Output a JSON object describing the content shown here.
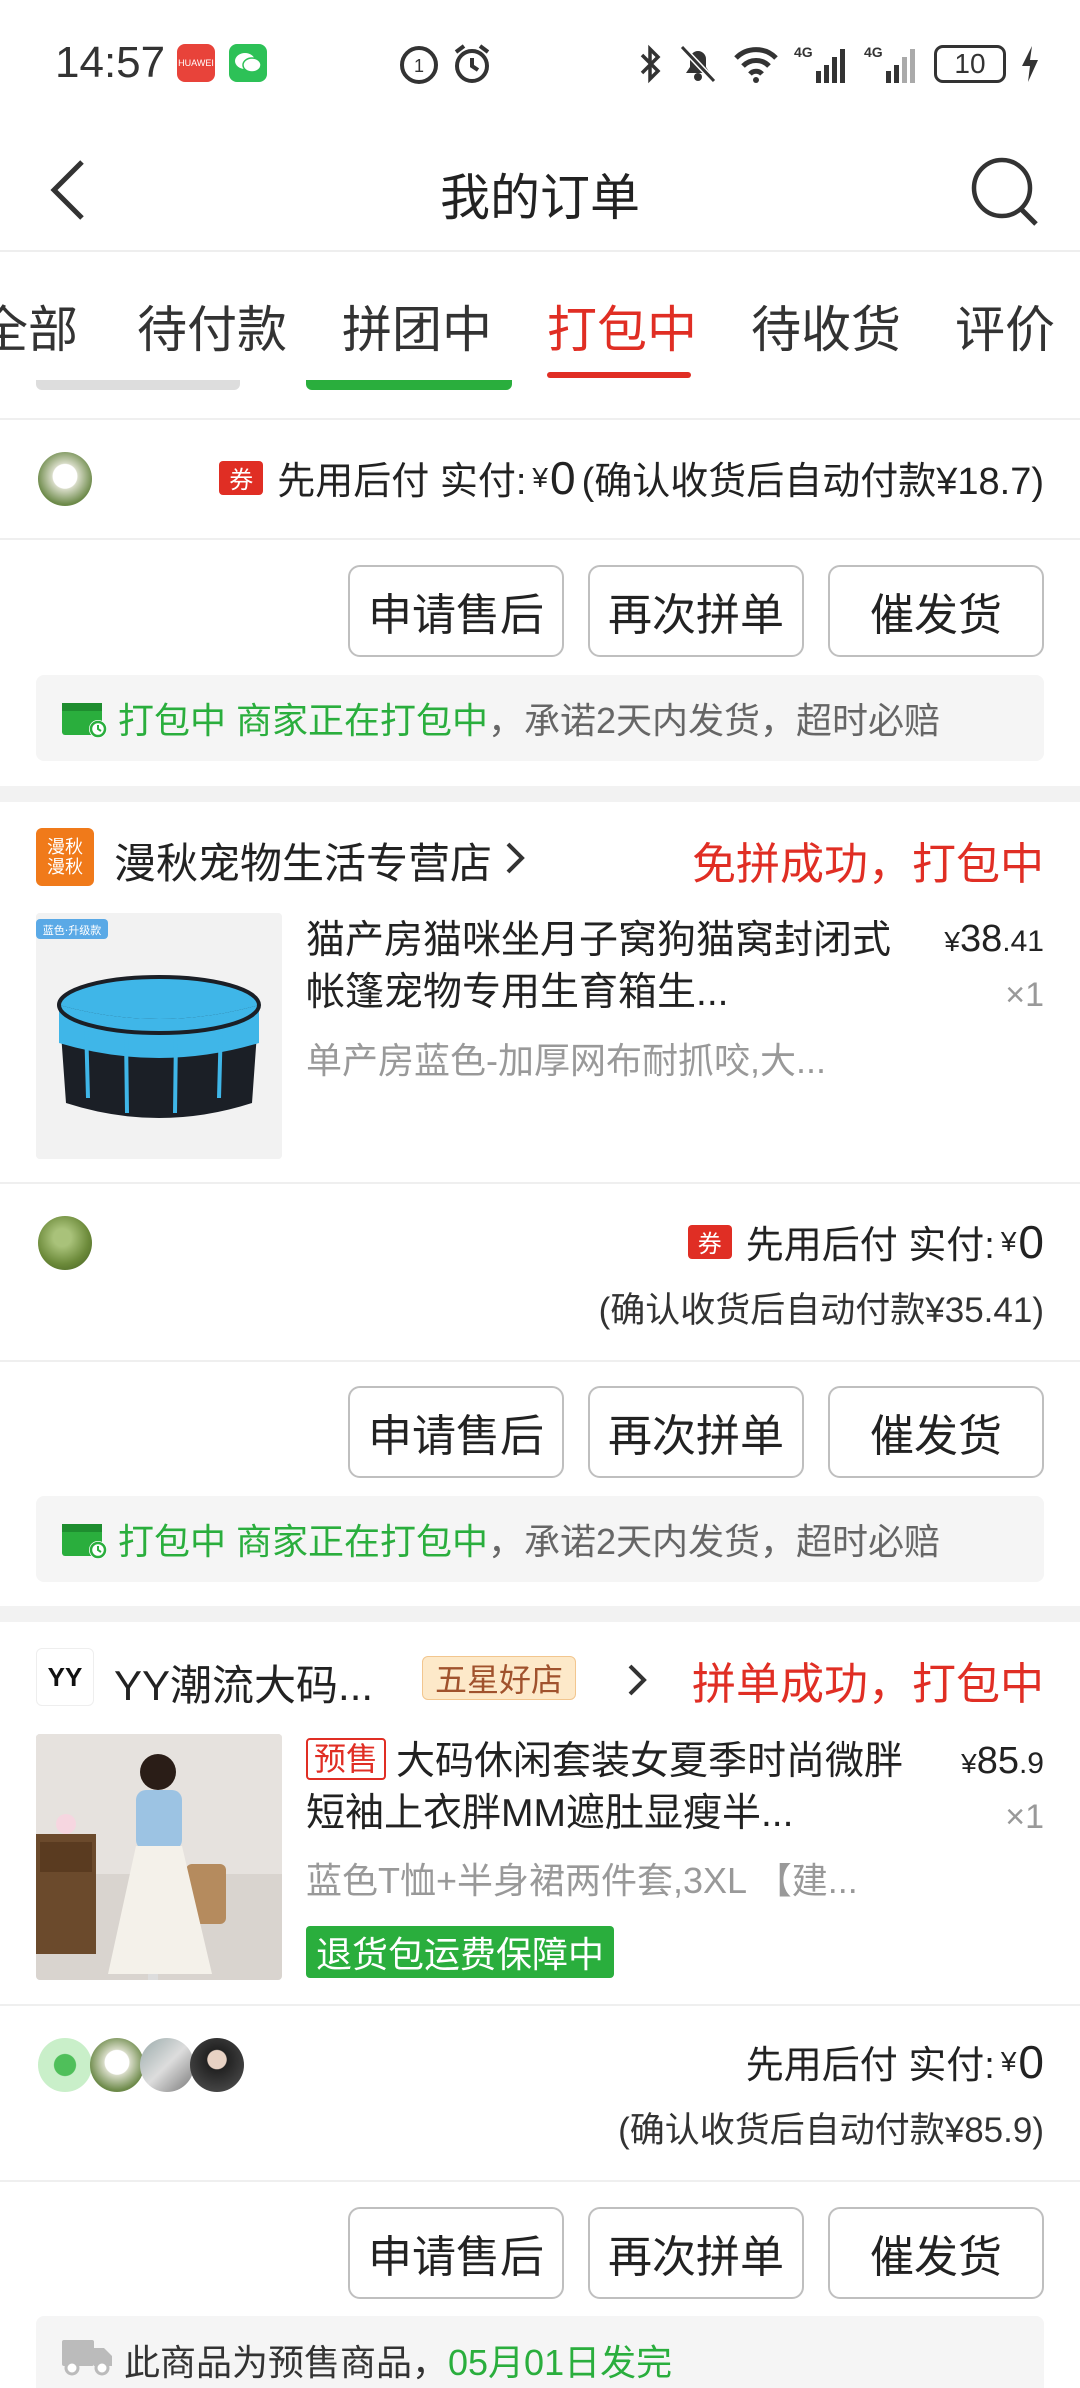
{
  "status_bar": {
    "time": "14:57",
    "battery": "10",
    "badges": [
      "HUAWEI"
    ]
  },
  "nav": {
    "title": "我的订单"
  },
  "tabs": [
    {
      "label": "全部"
    },
    {
      "label": "待付款"
    },
    {
      "label": "拼团中"
    },
    {
      "label": "打包中",
      "active": true
    },
    {
      "label": "待收货"
    },
    {
      "label": "评价"
    }
  ],
  "order1": {
    "coupon": "券",
    "pay_label": "先用后付 实付:",
    "yen": "¥",
    "paid": "0",
    "auto_pay_note": "(确认收货后自动付款¥18.7)",
    "buttons": [
      "申请售后",
      "再次拼单",
      "催发货"
    ],
    "notice_status": "打包中 商家正在打包中",
    "notice_rest": "，承诺2天内发货，超时必赔"
  },
  "order2": {
    "store_logo": [
      "漫秋",
      "漫秋"
    ],
    "store_name": "漫秋宠物生活专营店",
    "status": "免拼成功，打包中",
    "product_tag": "蓝色·升级款",
    "product_title": "猫产房猫咪坐月子窝狗猫窝封闭式帐篷宠物专用生育箱生...",
    "spec": "单产房蓝色-加厚网布耐抓咬,大...",
    "price_symbol": "¥",
    "price_int": "38",
    "price_dec": ".41",
    "qty": "×1",
    "coupon": "券",
    "pay_label": "先用后付 实付:",
    "yen": "¥",
    "paid": "0",
    "auto_pay_note": "(确认收货后自动付款¥35.41)",
    "buttons": [
      "申请售后",
      "再次拼单",
      "催发货"
    ],
    "notice_status": "打包中 商家正在打包中",
    "notice_rest": "，承诺2天内发货，超时必赔"
  },
  "order3": {
    "store_logo": "YY",
    "store_name": "YY潮流大码...",
    "star_badge": "五星好店",
    "status": "拼单成功，打包中",
    "presale_tag": "预售",
    "product_title": "大码休闲套装女夏季时尚微胖短袖上衣胖MM遮肚显瘦半...",
    "spec": "蓝色T恤+半身裙两件套,3XL 【建...",
    "guarantee": "退货包运费保障中",
    "price_symbol": "¥",
    "price_int": "85",
    "price_dec": ".9",
    "qty": "×1",
    "pay_label": "先用后付 实付:",
    "yen": "¥",
    "paid": "0",
    "auto_pay_note": "(确认收货后自动付款¥85.9)",
    "buttons": [
      "申请售后",
      "再次拼单",
      "催发货"
    ],
    "presale_notice": "此商品为预售商品，",
    "presale_date": "05月01日发完"
  },
  "colors": {
    "accent_red": "#e02e24",
    "accent_green": "#2aae3d"
  }
}
